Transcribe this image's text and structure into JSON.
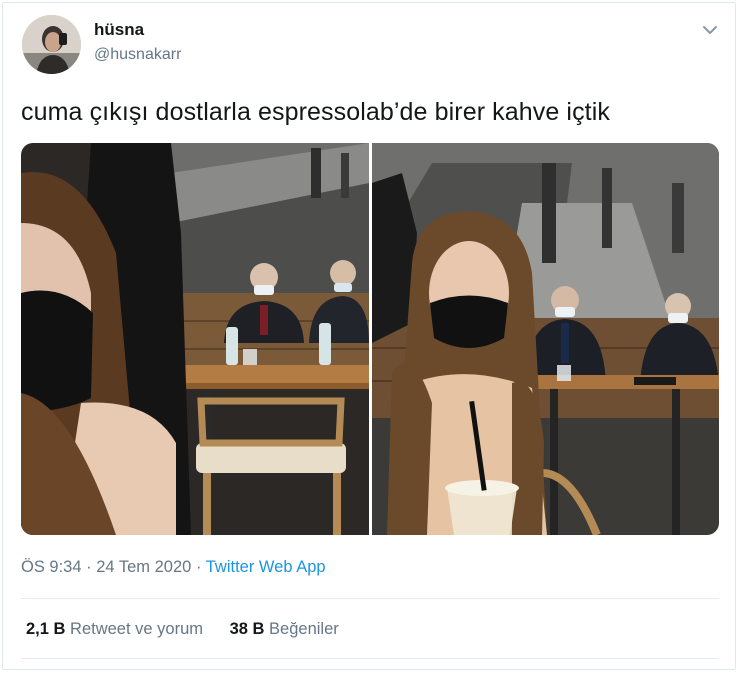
{
  "tweet": {
    "display_name": "hüsna",
    "handle": "@husnakarr",
    "text": "cuma çıkışı dostlarla espressolab’de birer kahve içtik",
    "meta": {
      "time": "ÖS 9:34",
      "separator": "·",
      "date": "24 Tem 2020",
      "source": "Twitter Web App"
    },
    "stats": {
      "retweets_count": "2,1 B",
      "retweets_label": "Retweet ve yorum",
      "likes_count": "38 B",
      "likes_label": "Beğeniler"
    }
  },
  "icons": {
    "menu": "chevron-down-icon"
  },
  "colors": {
    "text": "#14171a",
    "secondary": "#657786",
    "link": "#1b95e0",
    "border": "#e1e8ed"
  }
}
